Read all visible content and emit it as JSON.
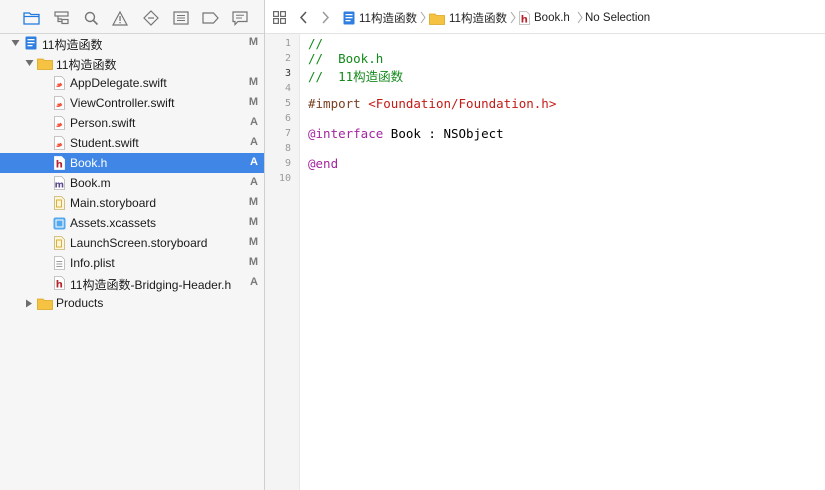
{
  "navigator": {
    "toolbar_icons": [
      "folder-icon",
      "hierarchy-icon",
      "search-icon",
      "warning-icon",
      "test-diamond-icon",
      "debug-icon",
      "breakpoint-icon",
      "report-icon"
    ],
    "tree": [
      {
        "label": "11构造函数",
        "status": "M",
        "icon": "project-icon",
        "disclosure": "open",
        "selected": false
      },
      {
        "label": "11构造函数",
        "status": "",
        "icon": "folder-icon",
        "disclosure": "open",
        "selected": false
      },
      {
        "label": "AppDelegate.swift",
        "status": "M",
        "icon": "swift-file-icon",
        "selected": false
      },
      {
        "label": "ViewController.swift",
        "status": "M",
        "icon": "swift-file-icon",
        "selected": false
      },
      {
        "label": "Person.swift",
        "status": "A",
        "icon": "swift-file-icon",
        "selected": false
      },
      {
        "label": "Student.swift",
        "status": "A",
        "icon": "swift-file-icon",
        "selected": false
      },
      {
        "label": "Book.h",
        "status": "A",
        "icon": "header-file-icon",
        "selected": true
      },
      {
        "label": "Book.m",
        "status": "A",
        "icon": "objc-file-icon",
        "selected": false
      },
      {
        "label": "Main.storyboard",
        "status": "M",
        "icon": "storyboard-file-icon",
        "selected": false
      },
      {
        "label": "Assets.xcassets",
        "status": "M",
        "icon": "assets-icon",
        "selected": false
      },
      {
        "label": "LaunchScreen.storyboard",
        "status": "M",
        "icon": "storyboard-file-icon",
        "selected": false
      },
      {
        "label": "Info.plist",
        "status": "M",
        "icon": "plist-file-icon",
        "selected": false
      },
      {
        "label": "11构造函数-Bridging-Header.h",
        "status": "A",
        "icon": "header-file-icon",
        "selected": false
      },
      {
        "label": "Products",
        "status": "",
        "icon": "folder-icon",
        "disclosure": "closed",
        "selected": false
      }
    ]
  },
  "jumpbar": {
    "crumbs": [
      {
        "label": "11构造函数",
        "icon": "project-icon"
      },
      {
        "label": "11构造函数",
        "icon": "folder-icon"
      },
      {
        "label": "Book.h",
        "icon": "header-file-icon"
      },
      {
        "label": "No Selection",
        "icon": ""
      }
    ]
  },
  "editor": {
    "current_line": 3,
    "line_numbers": [
      "1",
      "2",
      "3",
      "4",
      "5",
      "6",
      "7",
      "8",
      "9",
      "10"
    ],
    "lines": [
      [
        {
          "t": "//",
          "k": "comment"
        }
      ],
      [
        {
          "t": "//  Book.h",
          "k": "comment"
        }
      ],
      [
        {
          "t": "//  11构造函数",
          "k": "comment"
        }
      ],
      [],
      [
        {
          "t": "#import ",
          "k": "directive"
        },
        {
          "t": "<Foundation/Foundation.h>",
          "k": "string"
        }
      ],
      [],
      [
        {
          "t": "@interface",
          "k": "keyword"
        },
        {
          "t": " Book : NSObject",
          "k": "plain"
        }
      ],
      [],
      [
        {
          "t": "@end",
          "k": "keyword"
        }
      ],
      []
    ]
  },
  "colors": {
    "selection": "#3f86e6",
    "comment": "#138a1b",
    "keyword": "#a3259f",
    "string": "#c41a16",
    "directive": "#7a3f20",
    "toolbar_active": "#1f7ae0",
    "folder": "#f6c242"
  }
}
